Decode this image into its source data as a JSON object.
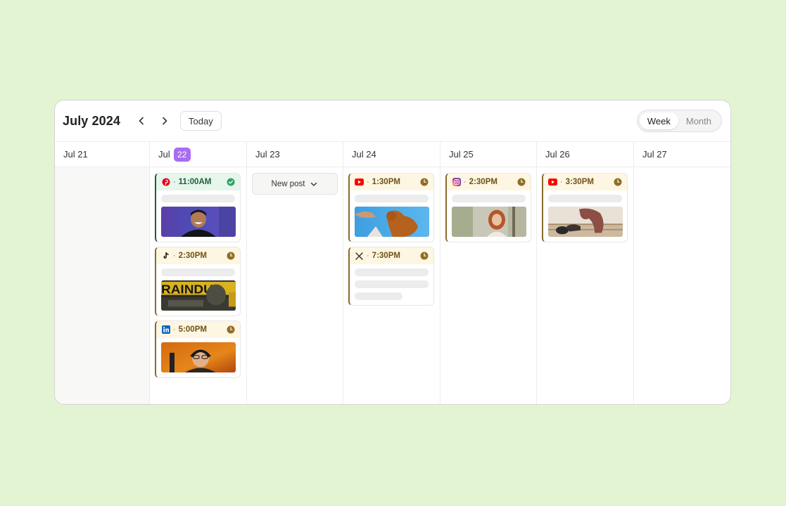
{
  "calendar": {
    "title": "July 2024",
    "today_label": "Today",
    "views": [
      "Week",
      "Month"
    ],
    "active_view": "Week"
  },
  "days": [
    {
      "label": "Jul 21"
    },
    {
      "label": "Jul",
      "badge": "22"
    },
    {
      "label": "Jul 23"
    },
    {
      "label": "Jul 24"
    },
    {
      "label": "Jul 25"
    },
    {
      "label": "Jul 26"
    },
    {
      "label": "Jul 27"
    }
  ],
  "new_post": {
    "label": "New post"
  },
  "posts": {
    "d22_a": {
      "platform": "pinterest-icon",
      "time": "11:00AM",
      "status": "published"
    },
    "d22_b": {
      "platform": "tiktok-icon",
      "time": "2:30PM",
      "status": "scheduled"
    },
    "d22_c": {
      "platform": "linkedin-icon",
      "time": "5:00PM",
      "status": "scheduled"
    },
    "d24_a": {
      "platform": "youtube-icon",
      "time": "1:30PM",
      "status": "scheduled"
    },
    "d24_b": {
      "platform": "x-icon",
      "time": "7:30PM",
      "status": "scheduled"
    },
    "d25_a": {
      "platform": "instagram-icon",
      "time": "2:30PM",
      "status": "scheduled"
    },
    "d26_a": {
      "platform": "youtube-icon",
      "time": "3:30PM",
      "status": "scheduled"
    }
  },
  "colors": {
    "background": "#e3f4d2",
    "today_badge": "#a96cf2",
    "scheduled_accent": "#8a6a2c",
    "published_accent": "#1e5e3b"
  }
}
